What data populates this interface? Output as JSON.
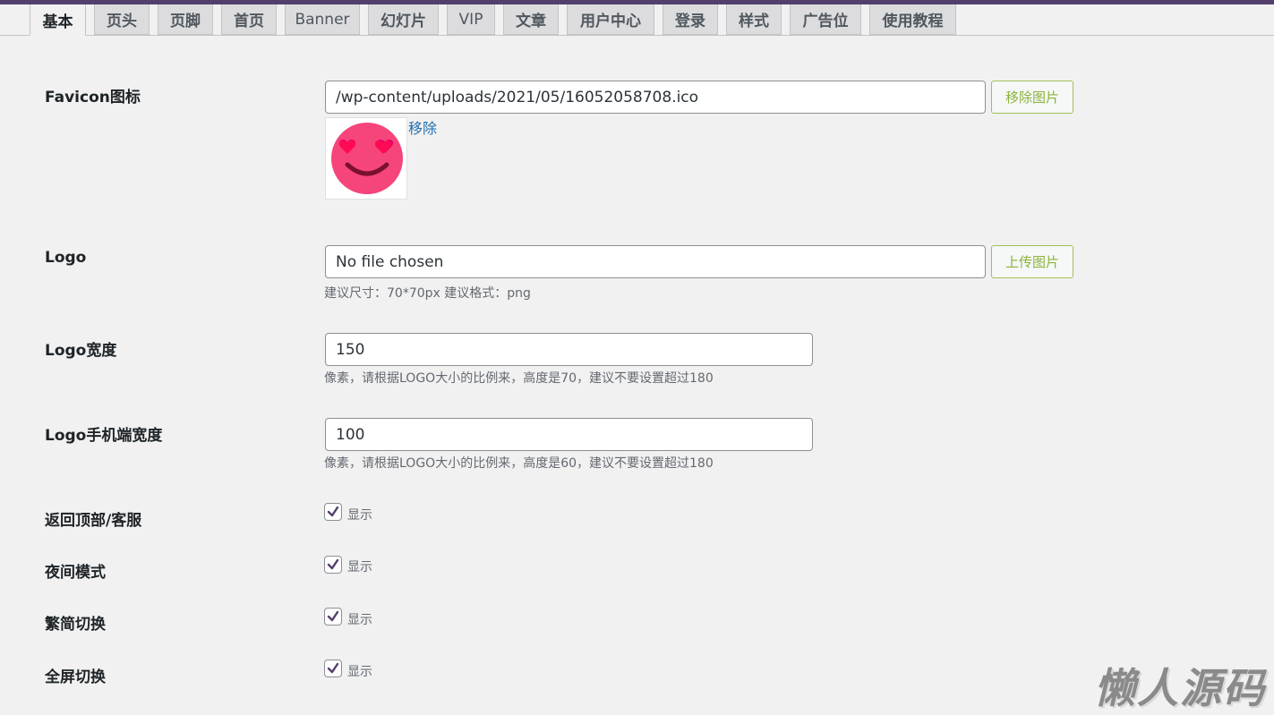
{
  "tabs": [
    {
      "label": "基本",
      "active": true
    },
    {
      "label": "页头"
    },
    {
      "label": "页脚"
    },
    {
      "label": "首页"
    },
    {
      "label": "Banner"
    },
    {
      "label": "幻灯片"
    },
    {
      "label": "VIP"
    },
    {
      "label": "文章"
    },
    {
      "label": "用户中心"
    },
    {
      "label": "登录"
    },
    {
      "label": "样式"
    },
    {
      "label": "广告位"
    },
    {
      "label": "使用教程"
    }
  ],
  "favicon": {
    "label": "Favicon图标",
    "value": "/wp-content/uploads/2021/05/16052058708.ico",
    "button": "移除图片",
    "remove_link": "移除"
  },
  "logo": {
    "label": "Logo",
    "value": "No file chosen",
    "button": "上传图片",
    "hint": "建议尺寸：70*70px 建议格式：png"
  },
  "logo_width": {
    "label": "Logo宽度",
    "value": "150",
    "hint": "像素，请根据LOGO大小的比例来，高度是70，建议不要设置超过180"
  },
  "logo_mobile_width": {
    "label": "Logo手机端宽度",
    "value": "100",
    "hint": "像素，请根据LOGO大小的比例来，高度是60，建议不要设置超过180"
  },
  "toggles": [
    {
      "label": "返回顶部/客服",
      "option": "显示",
      "checked": true
    },
    {
      "label": "夜间模式",
      "option": "显示",
      "checked": true
    },
    {
      "label": "繁简切换",
      "option": "显示",
      "checked": true
    },
    {
      "label": "全屏切换",
      "option": "显示",
      "checked": true
    }
  ],
  "watermark": "懒人源码",
  "colors": {
    "accent": "#523f6d",
    "button_text": "#8ab43c",
    "link": "#2271b1",
    "emoji_face": "#f5457a"
  }
}
